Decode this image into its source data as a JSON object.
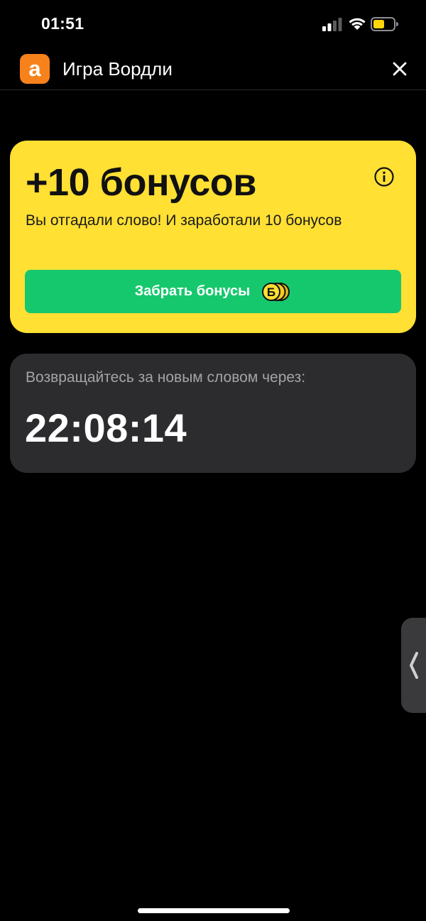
{
  "status_bar": {
    "time": "01:51",
    "icons": [
      "signal-icon",
      "wifi-icon",
      "battery-icon"
    ],
    "battery_color": "#ffd60a"
  },
  "header": {
    "logo_glyph": "a",
    "title": "Игра Вордли",
    "close_icon": "close-icon"
  },
  "bonus_card": {
    "title": "+10 бонусов",
    "description": "Вы отгадали слово! И заработали 10 бонусов",
    "button_label": "Забрать бонусы",
    "coin_glyph": "Б",
    "info_icon": "info-icon",
    "background": "#ffe033",
    "button_color": "#16c86d"
  },
  "timer_card": {
    "caption": "Возвращайтесь за новым словом через:",
    "countdown": "22:08:14",
    "background": "#2c2c2e"
  },
  "colors": {
    "background": "#000000",
    "brand_orange": "#f7821b"
  }
}
